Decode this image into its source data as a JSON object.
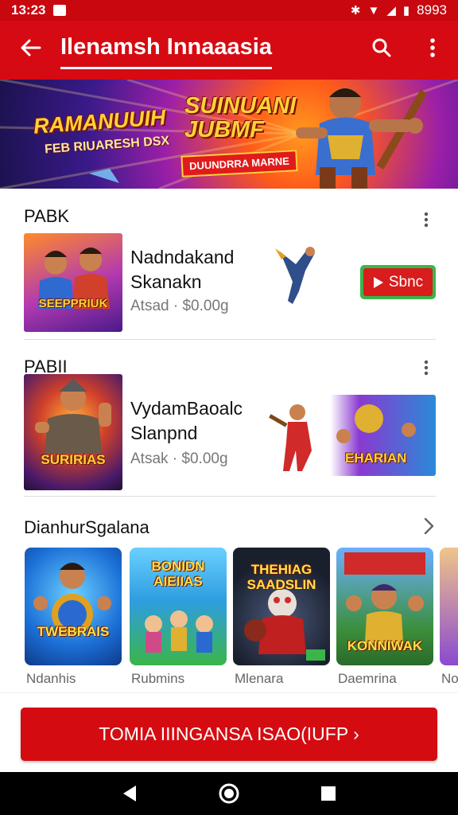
{
  "status_bar": {
    "time": "13:23",
    "battery_text": "8993"
  },
  "app_bar": {
    "title": "Ilenamsh Innaaasia"
  },
  "banner": {
    "left_title": "RAMANUUIH",
    "left_subtitle": "FEB RIUARESH DSX",
    "right_title_1": "SUINUANI",
    "right_title_2": "JUBMF",
    "tag": "DUUNDRRA MARNE"
  },
  "section1": {
    "header": "PABK",
    "game": {
      "thumb_title": "SEEPPRIUK",
      "name_line1": "Nadndakand",
      "name_line2": "Skanakn",
      "meta": "Atsad · $0.00g"
    },
    "button_label": "Sbnc"
  },
  "section2": {
    "header": "PABII",
    "game": {
      "thumb_title": "SURIRIAS",
      "name_line1": "VydamBaoalc",
      "name_line2": "Slanpnd",
      "meta": "Atsak · $0.00g"
    },
    "promo_title": "EHARIAN"
  },
  "section3": {
    "header": "DianhurSgalana",
    "tiles": [
      {
        "title": "TWEBRAIS",
        "label": "Ndanhis",
        "bg": "#1b6fd6"
      },
      {
        "title": "BONIDN AIEIIAS",
        "label": "Rubmins",
        "bg": "#2e9de0"
      },
      {
        "title": "THEHIAG SAADSLIN",
        "label": "Mlenara",
        "bg": "#1a1f2e"
      },
      {
        "title": "KONNIWAK",
        "label": "Daemrina",
        "bg": "#3b8e3a"
      },
      {
        "title": "",
        "label": "No",
        "bg": "#f0c48a"
      }
    ]
  },
  "cta": {
    "label": "TOMIA IIINGANSA ISAO(IUFP ›"
  },
  "colors": {
    "brand_red": "#d60a12",
    "button_green": "#3bb54a"
  }
}
